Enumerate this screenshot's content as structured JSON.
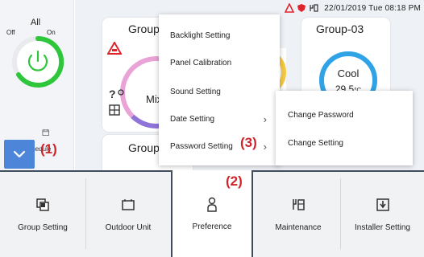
{
  "status": {
    "datetime": "22/01/2019 Tue 08:18 PM",
    "icons": [
      "warning-icon",
      "shield-icon",
      "maintenance-icon"
    ]
  },
  "left_panel": {
    "all_label": "All",
    "off_label": "Off",
    "on_label": "On",
    "schedule_label": "Schedule",
    "power_state": "on"
  },
  "cards": {
    "group_a_title": "Group",
    "group_a_mode_partial": "Mixe",
    "group_b_title": "Group",
    "group_03_title": "Group-03",
    "group_03_mode": "Cool",
    "group_03_temp": "29.5",
    "group_03_unit": "°C"
  },
  "menu": {
    "items": [
      {
        "label": "Backlight Setting"
      },
      {
        "label": "Panel Calibration"
      },
      {
        "label": "Sound Setting"
      },
      {
        "label": "Date Setting",
        "arrow": "›"
      },
      {
        "label": "Password Setting",
        "arrow": "›"
      }
    ]
  },
  "submenu": {
    "items": [
      {
        "label": "Change Password"
      },
      {
        "label": "Change Setting"
      }
    ]
  },
  "annotations": {
    "one": "(1)",
    "two": "(2)",
    "three": "(3)"
  },
  "bottom_bar": {
    "items": [
      {
        "label": "Group Setting",
        "icon": "group-setting-icon"
      },
      {
        "label": "Outdoor Unit",
        "icon": "outdoor-unit-icon"
      },
      {
        "label": "Preference",
        "icon": "preference-icon"
      },
      {
        "label": "Maintenance",
        "icon": "maintenance-icon"
      },
      {
        "label": "Installer Setting",
        "icon": "installer-setting-icon"
      }
    ]
  },
  "colors": {
    "accent_blue": "#4d86d9",
    "annotation_red": "#d1232a",
    "power_green": "#2ec63a",
    "cool_blue": "#2fa3e6",
    "warn_red": "#e0242c"
  }
}
